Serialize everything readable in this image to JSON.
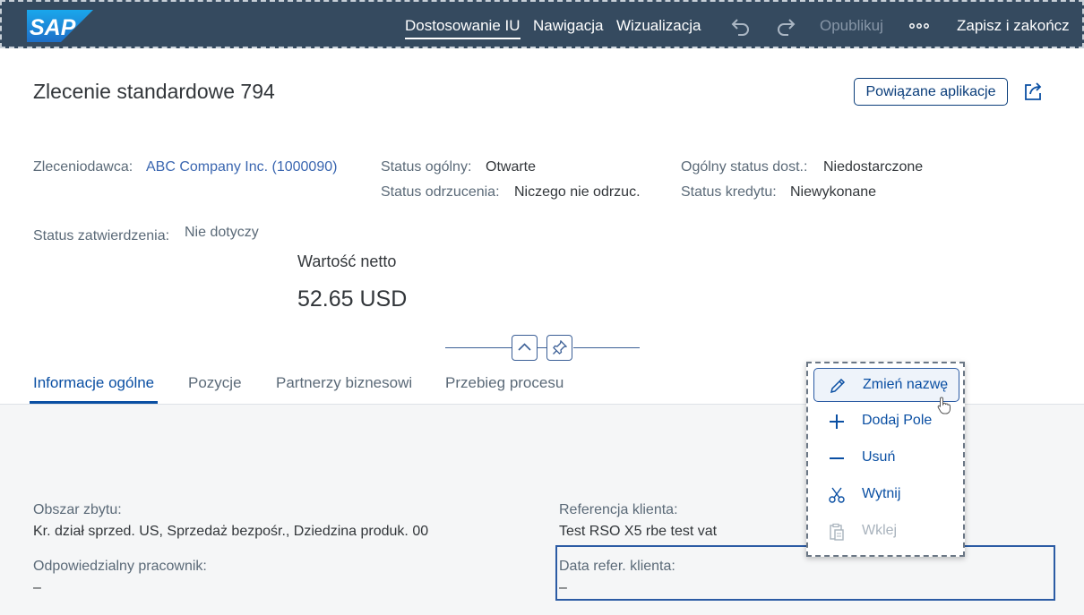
{
  "shell": {
    "logo_text": "SAP",
    "nav": [
      {
        "label": "Dostosowanie IU",
        "active": true
      },
      {
        "label": "Nawigacja",
        "active": false
      },
      {
        "label": "Wizualizacja",
        "active": false
      }
    ],
    "undo_icon": "undo-icon",
    "redo_icon": "redo-icon",
    "publish_label": "Opublikuj",
    "more_icon": "overflow-icon",
    "save_exit_label": "Zapisz i zakończ"
  },
  "header": {
    "title": "Zlecenie standardowe 794",
    "related_apps_label": "Powiązane aplikacje",
    "share_icon": "share-icon",
    "attributes": {
      "customer_label": "Zleceniodawca:",
      "customer_value": "ABC Company Inc. (1000090)",
      "overall_status_label": "Status ogólny:",
      "overall_status_value": "Otwarte",
      "rejection_status_label": "Status odrzucenia:",
      "rejection_status_value": "Niczego nie odrzuc.",
      "delivery_status_label": "Ogólny status dost.:",
      "delivery_status_value": "Niedostarczone",
      "credit_status_label": "Status kredytu:",
      "credit_status_value": "Niewykonane",
      "approval_status_label": "Status zatwierdzenia:",
      "approval_status_value": "Nie dotyczy"
    },
    "kpi": {
      "label": "Wartość netto",
      "value": "52.65  USD"
    }
  },
  "tabs": [
    {
      "label": "Informacje ogólne",
      "active": true
    },
    {
      "label": "Pozycje",
      "active": false
    },
    {
      "label": "Partnerzy biznesowi",
      "active": false
    },
    {
      "label": "Przebieg procesu",
      "active": false
    }
  ],
  "fields": {
    "sales_area_label": "Obszar zbytu:",
    "sales_area_value": "Kr. dział sprzed. US, Sprzedaż bezpośr., Dziedzina produk. 00",
    "customer_ref_label": "Referencja klienta:",
    "customer_ref_value": "Test RSO X5 rbe test vat",
    "responsible_label": "Odpowiedzialny pracownik:",
    "responsible_value": "–",
    "customer_ref_date_label": "Data refer. klienta:",
    "customer_ref_date_value": "–"
  },
  "context_menu": {
    "items": [
      {
        "label": "Zmień nazwę",
        "icon": "pencil-icon",
        "state": "hover"
      },
      {
        "label": "Dodaj Pole",
        "icon": "plus-icon",
        "state": "enabled"
      },
      {
        "label": "Usuń",
        "icon": "minus-icon",
        "state": "enabled"
      },
      {
        "label": "Wytnij",
        "icon": "scissors-icon",
        "state": "enabled"
      },
      {
        "label": "Wklej",
        "icon": "paste-icon",
        "state": "disabled"
      }
    ]
  },
  "colors": {
    "shell_bg": "#354a5f",
    "brand_blue": "#0a4fa3",
    "link_blue": "#3a66b0"
  }
}
